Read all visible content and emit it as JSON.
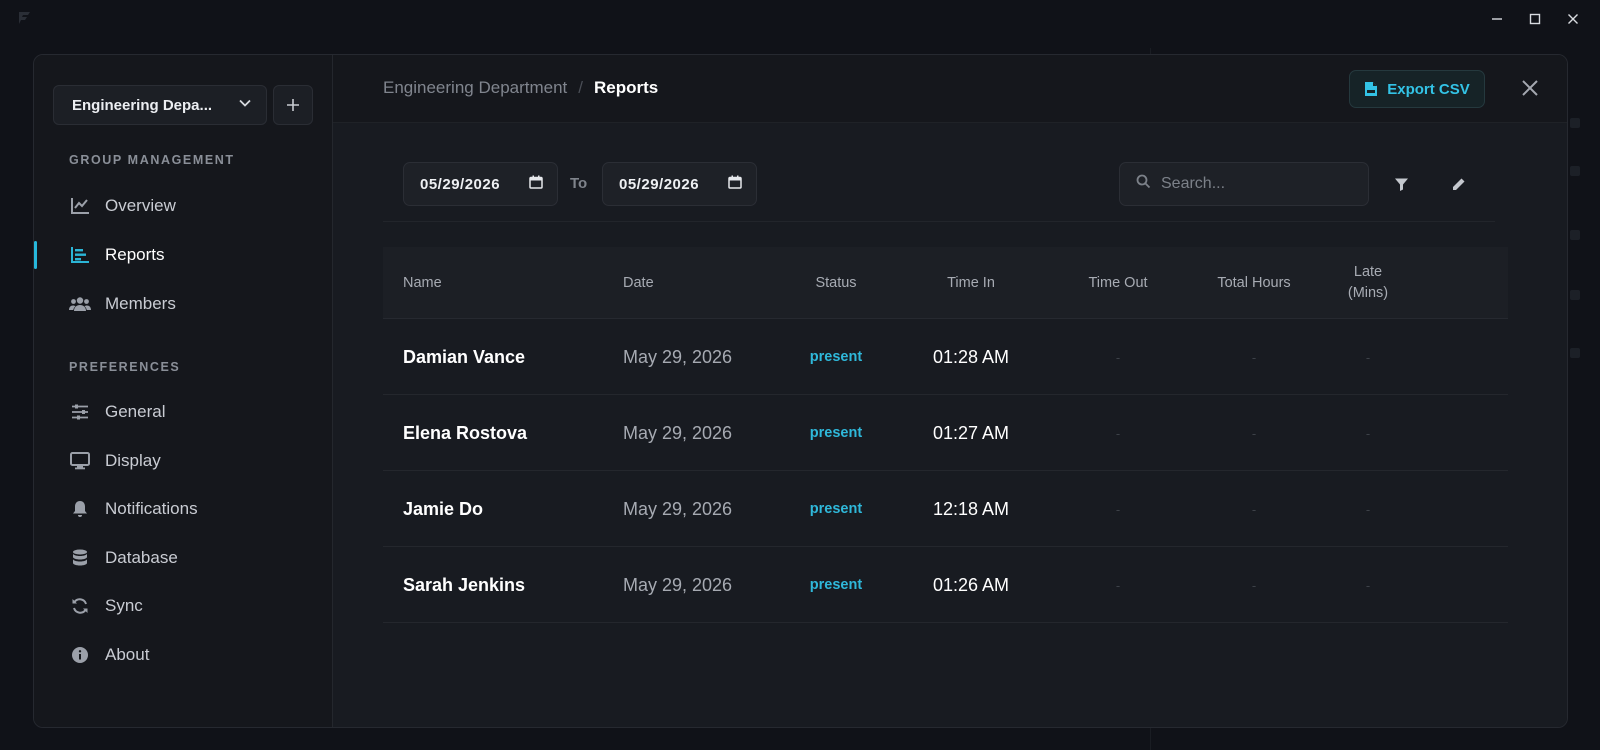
{
  "window": {
    "controls": [
      "minimize-icon",
      "maximize-icon",
      "close-icon"
    ]
  },
  "sidebar": {
    "department": "Engineering Depa...",
    "sections": [
      {
        "label": "GROUP MANAGEMENT",
        "items": [
          {
            "label": "Overview",
            "icon": "chart-line-icon",
            "active": false
          },
          {
            "label": "Reports",
            "icon": "chart-bar-icon",
            "active": true
          },
          {
            "label": "Members",
            "icon": "users-icon",
            "active": false
          }
        ]
      },
      {
        "label": "PREFERENCES",
        "items": [
          {
            "label": "General",
            "icon": "sliders-icon",
            "active": false
          },
          {
            "label": "Display",
            "icon": "monitor-icon",
            "active": false
          },
          {
            "label": "Notifications",
            "icon": "bell-icon",
            "active": false
          },
          {
            "label": "Database",
            "icon": "database-icon",
            "active": false
          },
          {
            "label": "Sync",
            "icon": "sync-icon",
            "active": false
          },
          {
            "label": "About",
            "icon": "info-icon",
            "active": false
          }
        ]
      }
    ]
  },
  "header": {
    "breadcrumb_parent": "Engineering Department",
    "breadcrumb_separator": "/",
    "breadcrumb_current": "Reports",
    "export_label": "Export CSV"
  },
  "filters": {
    "date_from": "05/29/2026",
    "to_label": "To",
    "date_to": "05/29/2026",
    "search_placeholder": "Search..."
  },
  "table": {
    "columns": [
      "Name",
      "Date",
      "Status",
      "Time In",
      "Time Out",
      "Total Hours",
      "Late\n(Mins)"
    ],
    "rows": [
      {
        "name": "Damian Vance",
        "date": "May 29, 2026",
        "status": "present",
        "time_in": "01:28 AM",
        "time_out": "-",
        "total_hours": "-",
        "late": "-"
      },
      {
        "name": "Elena Rostova",
        "date": "May 29, 2026",
        "status": "present",
        "time_in": "01:27 AM",
        "time_out": "-",
        "total_hours": "-",
        "late": "-"
      },
      {
        "name": "Jamie Do",
        "date": "May 29, 2026",
        "status": "present",
        "time_in": "12:18 AM",
        "time_out": "-",
        "total_hours": "-",
        "late": "-"
      },
      {
        "name": "Sarah Jenkins",
        "date": "May 29, 2026",
        "status": "present",
        "time_in": "01:26 AM",
        "time_out": "-",
        "total_hours": "-",
        "late": "-"
      }
    ]
  },
  "colors": {
    "accent": "#2bb5d6",
    "background": "#101218",
    "panel": "#17191f"
  }
}
